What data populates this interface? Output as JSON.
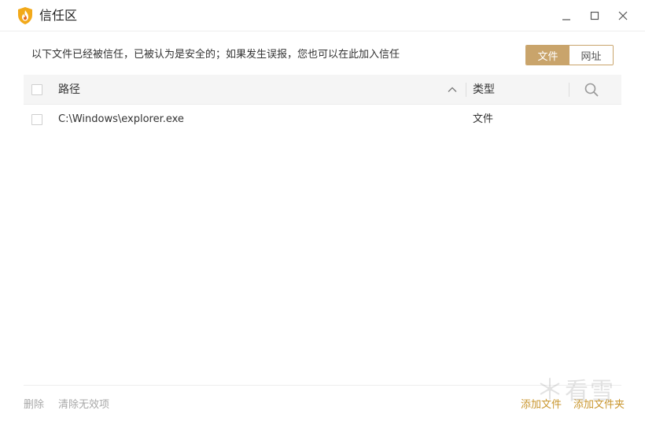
{
  "window": {
    "title": "信任区"
  },
  "description": "以下文件已经被信任，已被认为是安全的；如果发生误报，您也可以在此加入信任",
  "toggle": {
    "file": "文件",
    "url": "网址",
    "active": "file"
  },
  "table": {
    "columns": {
      "path": "路径",
      "type": "类型"
    },
    "rows": [
      {
        "path": "C:\\Windows\\explorer.exe",
        "type": "文件"
      }
    ]
  },
  "footer": {
    "delete": "删除",
    "clear_invalid": "清除无效项",
    "add_file": "添加文件",
    "add_folder": "添加文件夹"
  },
  "watermark": {
    "text": "看雪"
  },
  "colors": {
    "accent": "#c9a46b",
    "link": "#c9962e",
    "disabled": "#a8a8a8",
    "logo_shield": "#f2a91a",
    "logo_flame": "#e8661a"
  }
}
